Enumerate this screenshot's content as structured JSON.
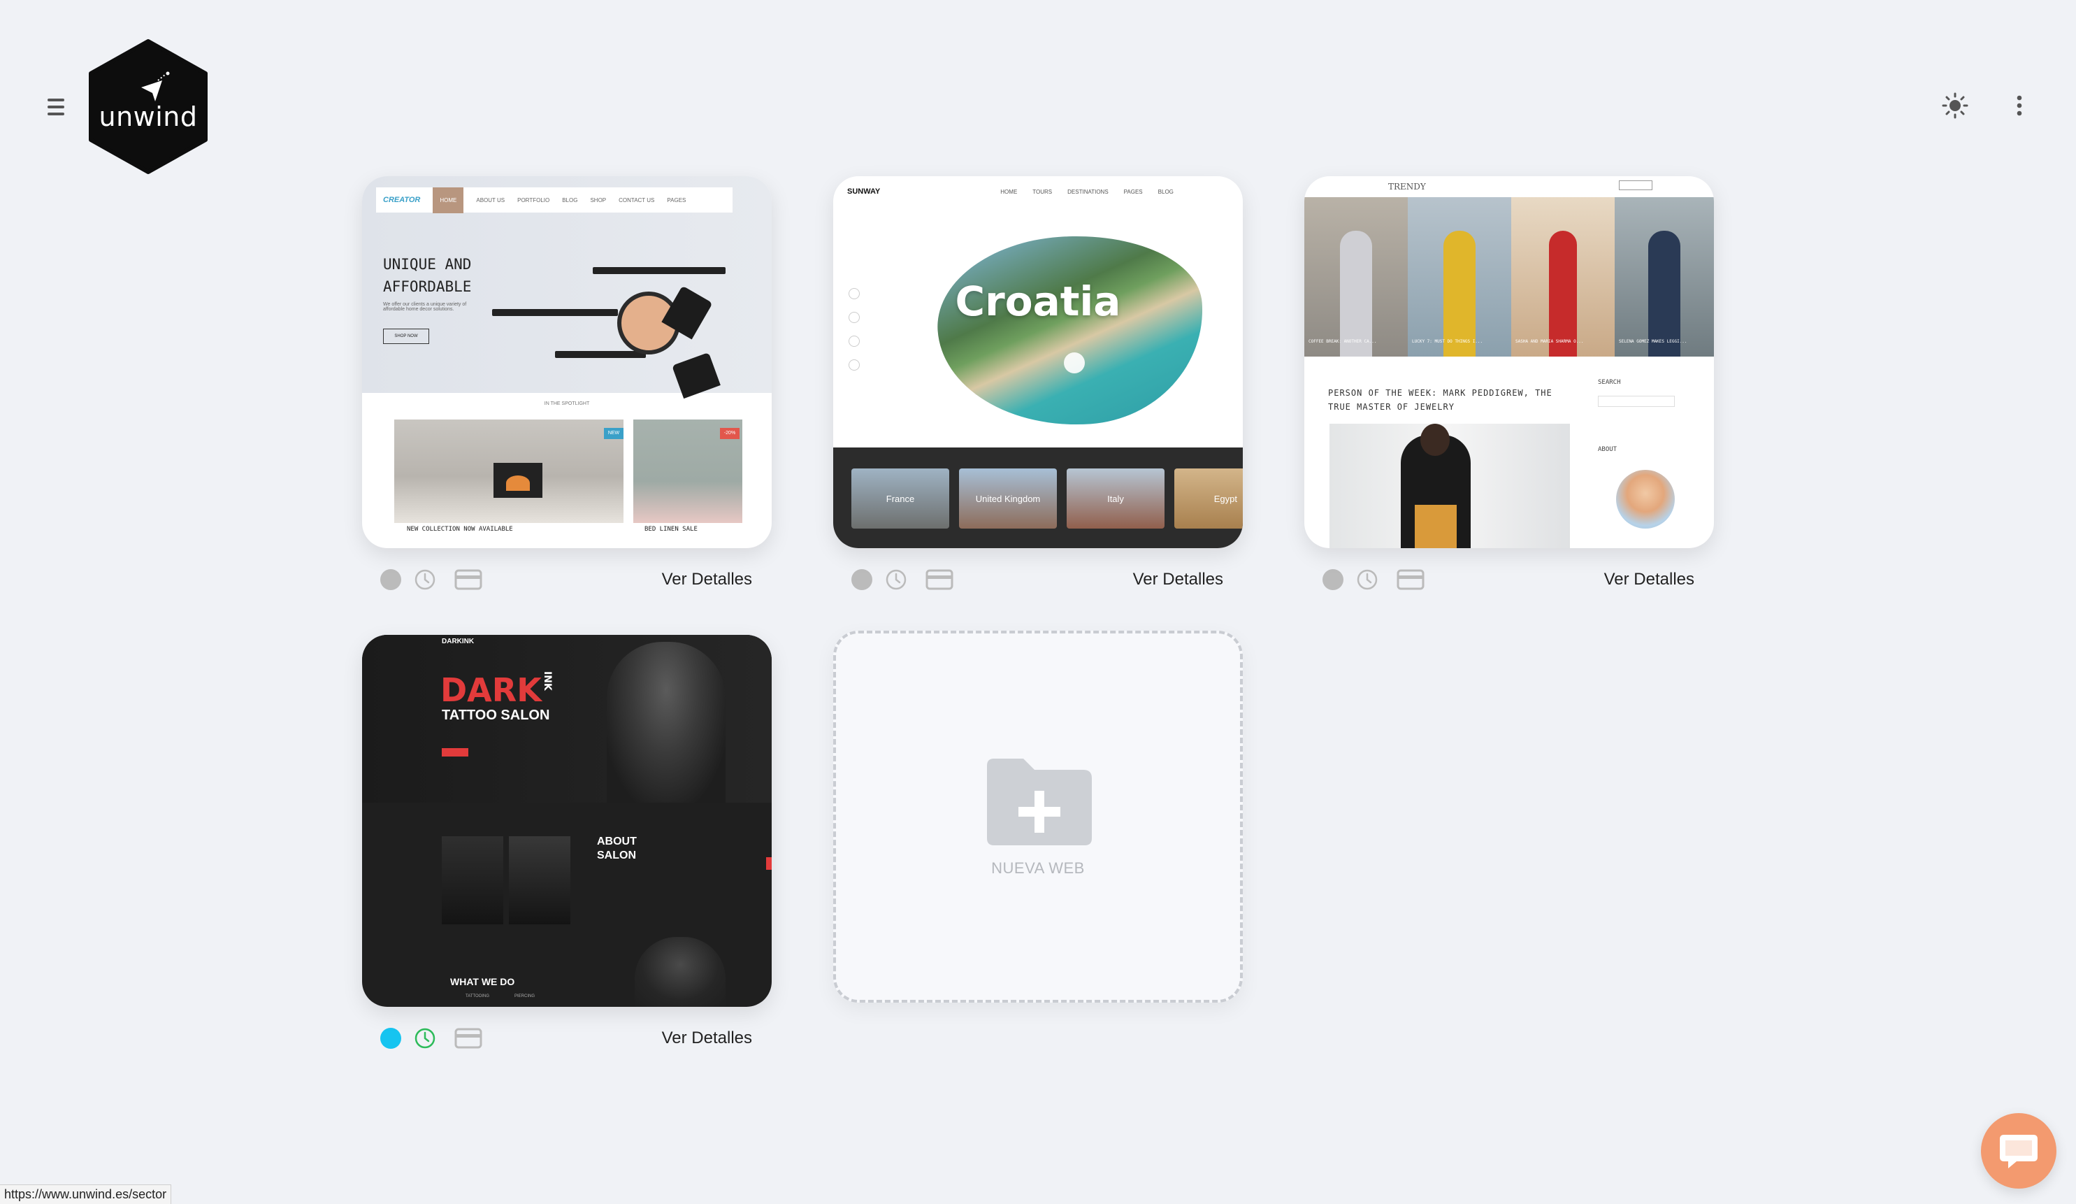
{
  "header": {
    "logo_text": "unwind",
    "menu_icon": "hamburger-icon",
    "theme_icon": "sun-icon",
    "more_icon": "kebab-menu-icon"
  },
  "cards": [
    {
      "id": "creator",
      "details_label": "Ver Detalles",
      "status": "inactive",
      "thumb": {
        "brand": "CREATOR",
        "nav": [
          "HOME",
          "ABOUT US",
          "PORTFOLIO",
          "BLOG",
          "SHOP",
          "CONTACT US",
          "PAGES"
        ],
        "headline_line1": "UNIQUE AND",
        "headline_line2": "AFFORDABLE",
        "blurb": "We offer our clients a unique variety of affordable home decor solutions.",
        "button": "SHOP NOW",
        "spotlight": "IN THE SPOTLIGHT",
        "badge_new": "NEW",
        "badge_sale": "-20%",
        "caption1": "NEW COLLECTION NOW AVAILABLE",
        "caption2": "BED LINEN SALE"
      }
    },
    {
      "id": "sunway",
      "details_label": "Ver Detalles",
      "status": "inactive",
      "thumb": {
        "brand": "SUNWAY",
        "nav": [
          "HOME",
          "TOURS",
          "DESTINATIONS",
          "PAGES",
          "BLOG"
        ],
        "title": "Croatia",
        "destinations": [
          "France",
          "United Kingdom",
          "Italy",
          "Egypt"
        ]
      }
    },
    {
      "id": "trendy",
      "details_label": "Ver Detalles",
      "status": "inactive",
      "thumb": {
        "brand": "TRENDY",
        "captions": [
          "COFFEE BREAK: ANOTHER CA...",
          "LUCKY 7: MUST DO THINGS I...",
          "SASHA AND MARIA SHARMA O...",
          "SELENA GOMEZ MAKES LEGGI..."
        ],
        "headline": "PERSON OF THE WEEK: MARK PEDDIGREW, THE TRUE MASTER OF JEWELRY",
        "search_label": "SEARCH",
        "about_label": "ABOUT"
      }
    },
    {
      "id": "darkink",
      "details_label": "Ver Detalles",
      "status": "active",
      "thumb": {
        "brand": "DARKINK",
        "dark": "DARK",
        "ink": "INK",
        "subtitle": "TATTOO SALON",
        "about": "ABOUT SALON",
        "what": "WHAT WE DO",
        "services": [
          "TATTOOING",
          "PIERCING"
        ]
      }
    }
  ],
  "new_web": {
    "label": "NUEVA WEB",
    "icon": "folder-plus-icon"
  },
  "status_bar": {
    "url": "https://www.unwind.es/sector"
  },
  "chat": {
    "icon": "chat-bubble-icon"
  },
  "colors": {
    "background": "#f0f2f6",
    "active_dot": "#16c4f0",
    "active_clock": "#2dbb5a",
    "inactive": "#bbbbbb",
    "chat": "#f39a6f"
  }
}
